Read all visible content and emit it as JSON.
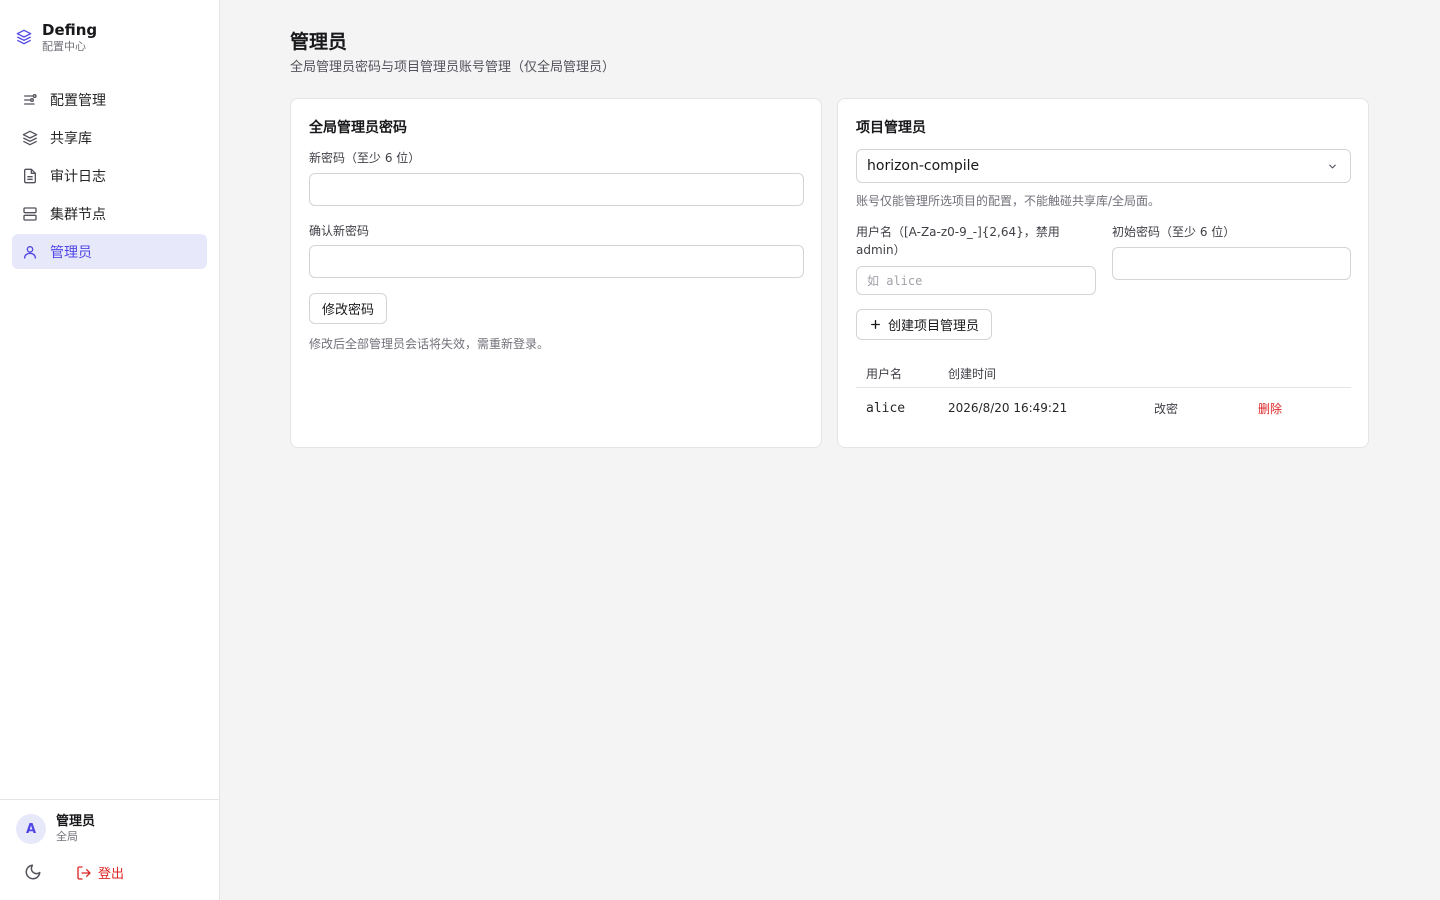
{
  "brand": {
    "name": "Defing",
    "subtitle": "配置中心"
  },
  "nav": [
    {
      "label": "配置管理",
      "icon": "sliders-icon"
    },
    {
      "label": "共享库",
      "icon": "layers-icon"
    },
    {
      "label": "审计日志",
      "icon": "file-text-icon"
    },
    {
      "label": "集群节点",
      "icon": "server-icon"
    },
    {
      "label": "管理员",
      "icon": "user-icon",
      "active": true
    }
  ],
  "user": {
    "avatar": "A",
    "name": "管理员",
    "role": "全局"
  },
  "footer": {
    "logout": "登出",
    "theme_icon": "moon-icon"
  },
  "page": {
    "title": "管理员",
    "subtitle": "全局管理员密码与项目管理员账号管理（仅全局管理员）"
  },
  "global_password": {
    "title": "全局管理员密码",
    "new_label": "新密码（至少 6 位）",
    "confirm_label": "确认新密码",
    "submit": "修改密码",
    "hint": "修改后全部管理员会话将失效，需重新登录。"
  },
  "project_admin": {
    "title": "项目管理员",
    "selected_project": "horizon-compile",
    "hint": "账号仅能管理所选项目的配置，不能触碰共享库/全局面。",
    "username_label": "用户名（[A-Za-z0-9_-]{2,64}，禁用 admin）",
    "username_placeholder": "如 alice",
    "password_label": "初始密码（至少 6 位）",
    "create_button": "创建项目管理员",
    "columns": {
      "username": "用户名",
      "created": "创建时间"
    },
    "rows": [
      {
        "username": "alice",
        "created": "2026/8/20 16:49:21",
        "change_pw": "改密",
        "delete": "删除"
      }
    ]
  },
  "colors": {
    "accent": "#4f46e5",
    "danger": "#dc2626",
    "active_bg": "#e8e8fb"
  }
}
